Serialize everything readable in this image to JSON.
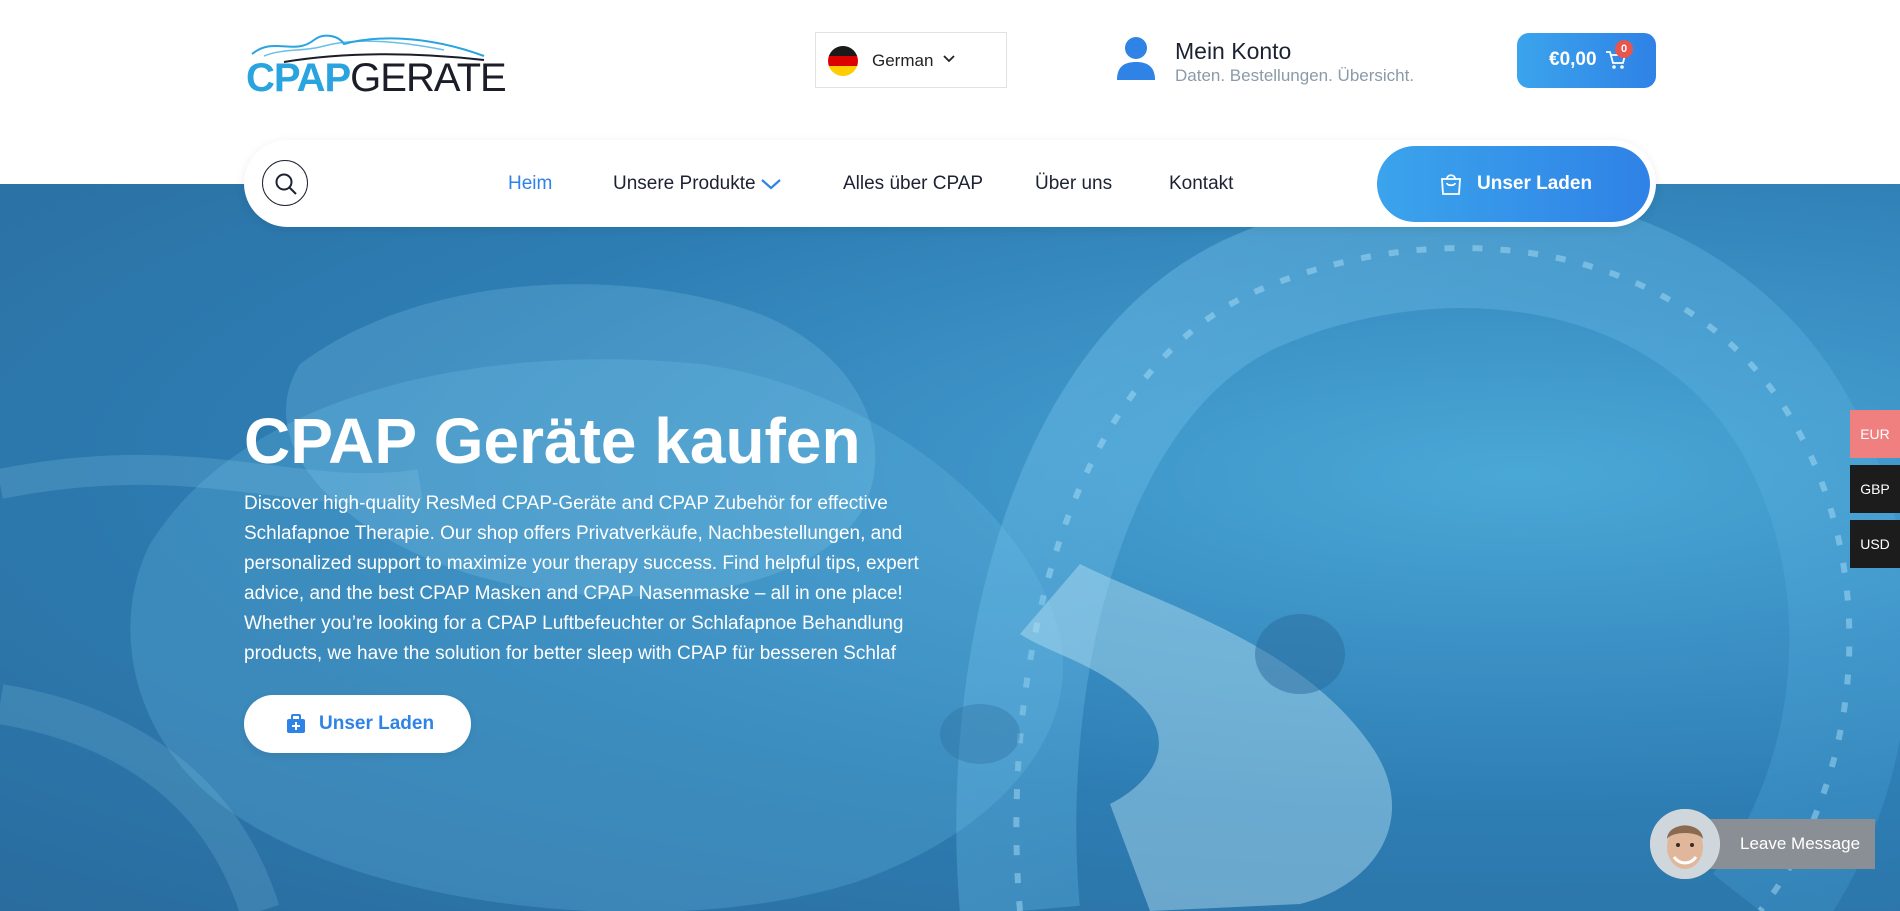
{
  "header": {
    "logo": {
      "part1": "CPAP",
      "part2": "GERATE"
    },
    "language": {
      "label": "German"
    },
    "account": {
      "title": "Mein Konto",
      "subtitle": "Daten. Bestellungen. Übersicht."
    },
    "cart": {
      "value": "€0,00",
      "badge": "0"
    }
  },
  "nav": {
    "items": [
      {
        "label": "Heim",
        "active": true
      },
      {
        "label": "Unsere Produkte",
        "has_dropdown": true
      },
      {
        "label": "Alles über CPAP"
      },
      {
        "label": "Über uns"
      },
      {
        "label": "Kontakt"
      }
    ],
    "shop_button": "Unser Laden"
  },
  "hero": {
    "title": "CPAP Geräte kaufen",
    "text": "Discover high-quality ResMed CPAP-Geräte and CPAP Zubehör for effective Schlafapnoe Therapie. Our shop offers Privatverkäufe, Nachbestellungen, and personalized support to maximize your therapy success. Find helpful tips, expert advice, and the best CPAP Masken and CPAP Nasenmaske – all in one place! Whether you’re looking for a CPAP Luftbefeuchter or Schlafapnoe Behandlung products, we have the solution for better sleep with CPAP für besseren Schlaf",
    "button": "Unser Laden"
  },
  "currency": [
    "EUR",
    "GBP",
    "USD"
  ],
  "chat": {
    "label": "Leave Message"
  },
  "colors": {
    "accent": "#2f82e6",
    "accent_light": "#3ba4ec",
    "hero_bg": "#3a8fc3",
    "badge": "#e8554e",
    "currency_active": "#f08080",
    "currency_inactive": "#1c1c1c"
  },
  "icons": {
    "search": "search-icon",
    "account": "user-icon",
    "cart": "cart-icon",
    "shop": "shopping-bag-icon",
    "hero_button": "medical-bag-icon",
    "language_dropdown": "chevron-down-icon"
  }
}
